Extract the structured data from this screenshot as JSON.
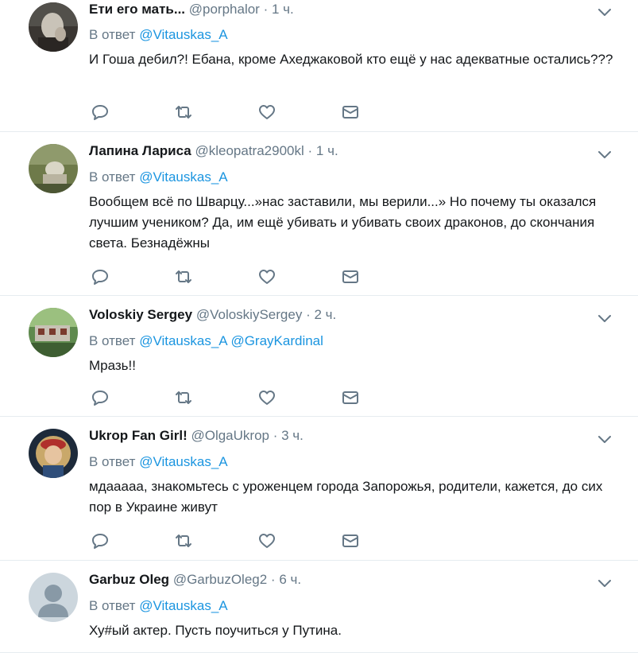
{
  "reply_prefix": "В ответ",
  "tweets": [
    {
      "name": "Ети его мать...",
      "handle": "@porphalor",
      "separator": "·",
      "time": "1 ч.",
      "mentions": [
        "@Vitauskas_A"
      ],
      "text": "И Гоша дебил?! Ебана, кроме Ахеджаковой кто ещё у нас адекватные остались???"
    },
    {
      "name": "Лапина Лариса",
      "handle": "@kleopatra2900kl",
      "separator": "·",
      "time": "1 ч.",
      "mentions": [
        "@Vitauskas_A"
      ],
      "text": "Вообщем всё по Шварцу...»нас заставили, мы верили...» Но почему ты оказался лучшим учеником? Да, им ещё убивать и убивать своих драконов, до скончания света. Безнадёжны"
    },
    {
      "name": "Voloskiy Sergey",
      "handle": "@VoloskiySergey",
      "separator": "·",
      "time": "2 ч.",
      "mentions": [
        "@Vitauskas_A",
        "@GrayKardinal"
      ],
      "text": "Мразь!!"
    },
    {
      "name": "Ukrop Fan Girl!",
      "handle": "@OlgaUkrop",
      "separator": "·",
      "time": "3 ч.",
      "mentions": [
        "@Vitauskas_A"
      ],
      "text": "мдааааа, знакомьтесь с уроженцем города Запорожья, родители, кажется, до сих пор в Украине живут"
    },
    {
      "name": "Garbuz Oleg",
      "handle": "@GarbuzOleg2",
      "separator": "·",
      "time": "6 ч.",
      "mentions": [
        "@Vitauskas_A"
      ],
      "text": "Ху#ый актер. Пусть поучиться у Путина."
    }
  ],
  "colors": {
    "link": "#1b95e0",
    "secondary_text": "#657786",
    "divider": "#e6ecf0",
    "icon": "#657786"
  },
  "icons": [
    "chevron-down-icon",
    "reply-icon",
    "retweet-icon",
    "like-icon",
    "direct-message-icon",
    "default-profile-icon"
  ]
}
